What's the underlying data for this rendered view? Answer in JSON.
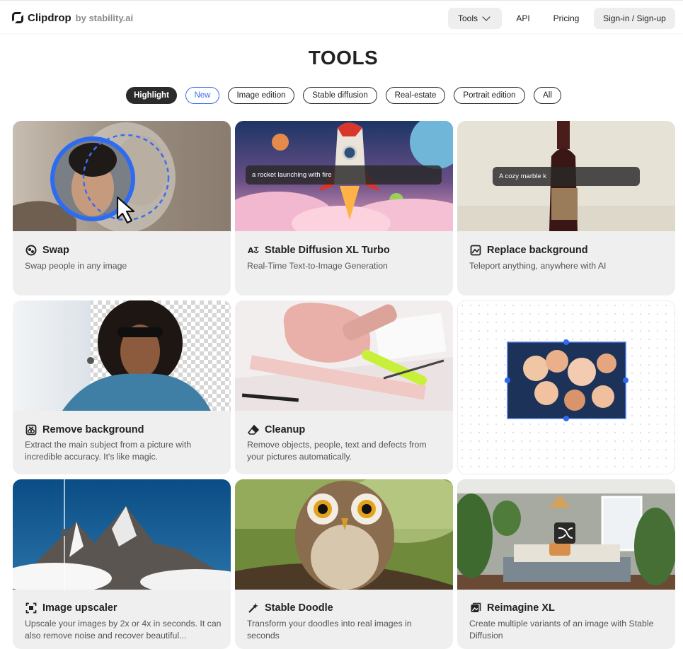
{
  "header": {
    "logo_name": "Clipdrop",
    "logo_by": "by stability.ai",
    "nav": {
      "tools": "Tools",
      "api": "API",
      "pricing": "Pricing",
      "signin": "Sign-in / Sign-up"
    }
  },
  "page_title": "TOOLS",
  "filters": [
    "Highlight",
    "New",
    "Image edition",
    "Stable diffusion",
    "Real-estate",
    "Portrait edition",
    "All"
  ],
  "active_filter": "Highlight",
  "cards": [
    {
      "title": "Swap",
      "description": "Swap people in any image",
      "icon": "swap-icon"
    },
    {
      "title": "Stable Diffusion XL Turbo",
      "description": "Real-Time Text-to-Image Generation",
      "icon": "text-to-image-icon",
      "prompt": "a rocket launching with fire"
    },
    {
      "title": "Replace background",
      "description": "Teleport anything, anywhere with AI",
      "icon": "replace-background-icon",
      "prompt": "A cozy marble k"
    },
    {
      "title": "Remove background",
      "description": "Extract the main subject from a picture with incredible accuracy. It's like magic.",
      "icon": "remove-background-icon"
    },
    {
      "title": "Cleanup",
      "description": "Remove objects, people, text and defects from your pictures automatically.",
      "icon": "eraser-icon"
    },
    {
      "title": "",
      "description": "",
      "icon": ""
    },
    {
      "title": "Image upscaler",
      "description": "Upscale your images by 2x or 4x in seconds. It can also remove noise and recover beautiful...",
      "icon": "upscale-icon"
    },
    {
      "title": "Stable Doodle",
      "description": "Transform your doodles into real images in seconds",
      "icon": "magic-wand-icon"
    },
    {
      "title": "Reimagine XL",
      "description": "Create multiple variants of an image with Stable Diffusion",
      "icon": "reimagine-icon"
    }
  ],
  "colors": {
    "accent_blue": "#3b6df0",
    "dark_chip": "#2b2b2b",
    "card_bg": "#efefef"
  }
}
